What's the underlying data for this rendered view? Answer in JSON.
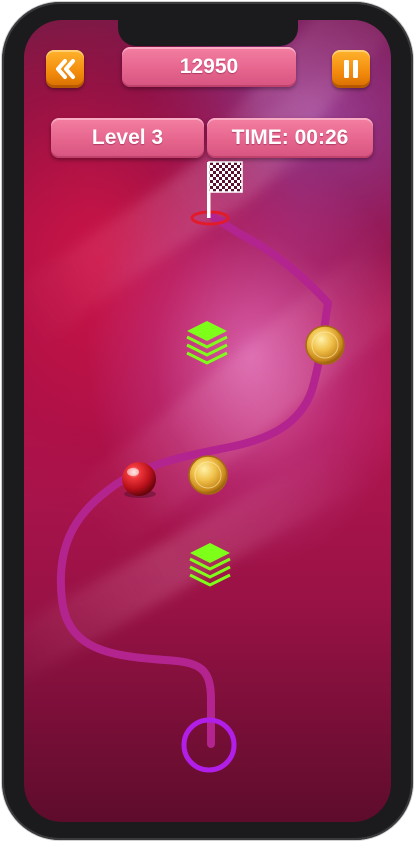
{
  "hud": {
    "score": "12950",
    "level": "Level 3",
    "time": "TIME: 00:26"
  },
  "icons": {
    "back": "double-chevron-left-icon",
    "pause": "pause-icon",
    "finish": "checkered-flag-icon",
    "powerup": "stacked-layers-icon",
    "coin": "gold-coin-icon",
    "ball": "red-ball-icon",
    "start": "start-ring-icon"
  },
  "colors": {
    "track": "#b3248f",
    "button_orange": "#f28a0c",
    "pill_pink": "#e6658e",
    "powerup_green": "#7dff1a",
    "start_ring": "#b11ee8",
    "ball_red": "#d0161c",
    "coin_gold": "#e7b335"
  }
}
